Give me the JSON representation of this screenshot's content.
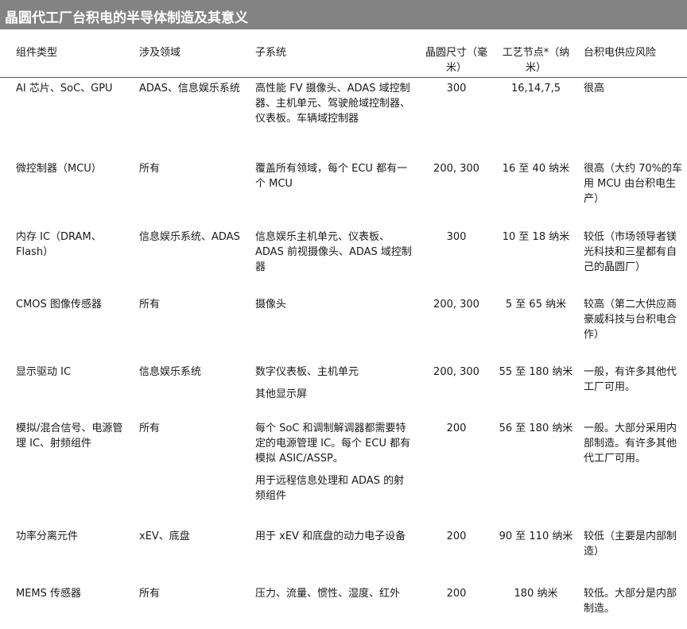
{
  "title": "晶圆代工厂台积电的半导体制造及其意义",
  "headers": {
    "component": "组件类型",
    "domain": "涉及领域",
    "subsystem": "子系统",
    "wafer": "晶圆尺寸（毫米）",
    "node": "工艺节点*（纳米）",
    "risk": "台积电供应风险"
  },
  "rows": [
    {
      "component": "AI 芯片、SoC、GPU",
      "domain": "ADAS、信息娱乐系统",
      "subsystem": [
        "高性能 FV 摄像头、ADAS 域控制器、主机单元、驾驶舱域控制器、仪表板。车辆域控制器"
      ],
      "wafer": "300",
      "node": "16,14,7,5",
      "risk": "很高"
    },
    {
      "component": "微控制器（MCU）",
      "domain": "所有",
      "subsystem": [
        "覆盖所有领域，每个 ECU 都有一个 MCU"
      ],
      "wafer": "200, 300",
      "node": "16 至 40 纳米",
      "risk": "很高（大约 70%的车用 MCU 由台积电生产）"
    },
    {
      "component": "内存 IC（DRAM、Flash）",
      "domain": "信息娱乐系统、ADAS",
      "subsystem": [
        "信息娱乐主机单元、仪表板、ADAS 前视摄像头、ADAS 域控制器"
      ],
      "wafer": "300",
      "node": "10 至 18 纳米",
      "risk": "较低（市场领导者镁光科技和三星都有自己的晶圆厂）"
    },
    {
      "component": "CMOS 图像传感器",
      "domain": "所有",
      "subsystem": [
        "摄像头"
      ],
      "wafer": "200, 300",
      "node": "5 至 65 纳米",
      "risk": "较高（第二大供应商豪威科技与台积电合作）"
    },
    {
      "component": "显示驱动 IC",
      "domain": "信息娱乐系统",
      "subsystem": [
        "数字仪表板、主机单元",
        "其他显示屏"
      ],
      "wafer": "200, 300",
      "node": "55 至 180 纳米",
      "risk": "一般，有许多其他代工厂可用。"
    },
    {
      "component": "模拟/混合信号、电源管理 IC、射频组件",
      "domain": "所有",
      "subsystem": [
        "每个 SoC 和调制解调器都需要特定的电源管理 IC。每个 ECU 都有模拟 ASIC/ASSP。",
        "用于远程信息处理和 ADAS 的射频组件"
      ],
      "wafer": "200",
      "node": "56 至 180 纳米",
      "risk": "一般。大部分采用内部制造。有许多其他代工厂可用。"
    },
    {
      "component": "功率分离元件",
      "domain": "xEV、底盘",
      "subsystem": [
        "用于 xEV 和底盘的动力电子设备"
      ],
      "wafer": "200",
      "node": "90 至 110 纳米",
      "risk": "较低（主要是内部制造）"
    },
    {
      "component": "MEMS 传感器",
      "domain": "所有",
      "subsystem": [
        "压力、流量、惯性、湿度、红外"
      ],
      "wafer": "200",
      "node": "180 纳米",
      "risk": "较低。大部分是内部制造。"
    }
  ]
}
